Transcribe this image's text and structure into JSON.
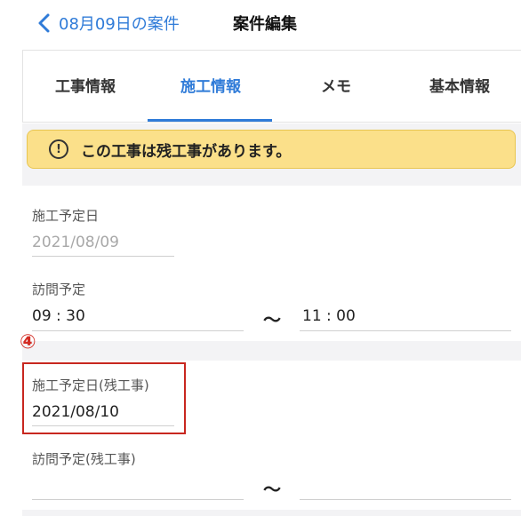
{
  "header": {
    "back_label": "08月09日の案件",
    "title": "案件編集"
  },
  "tabs": [
    {
      "label": "工事情報"
    },
    {
      "label": "施工情報"
    },
    {
      "label": "メモ"
    },
    {
      "label": "基本情報"
    }
  ],
  "active_tab": "施工情報",
  "alert": {
    "icon": "!",
    "message": "この工事は残工事があります。"
  },
  "form": {
    "construction_date_label": "施工予定日",
    "construction_date_value": "2021/08/09",
    "visit_label": "訪問予定",
    "visit_start": "09 : 30",
    "visit_separator": "〜",
    "visit_end": "11 : 00",
    "annotation_marker": "④",
    "remaining_date_label": "施工予定日(残工事)",
    "remaining_date_value": "2021/08/10",
    "remaining_visit_label": "訪問予定(残工事)",
    "remaining_visit_start": "",
    "remaining_visit_separator": "〜",
    "remaining_visit_end": ""
  },
  "colors": {
    "accent": "#2f7bd8",
    "alert_bg": "#fbe08a",
    "annotation_red": "#c8271f"
  }
}
